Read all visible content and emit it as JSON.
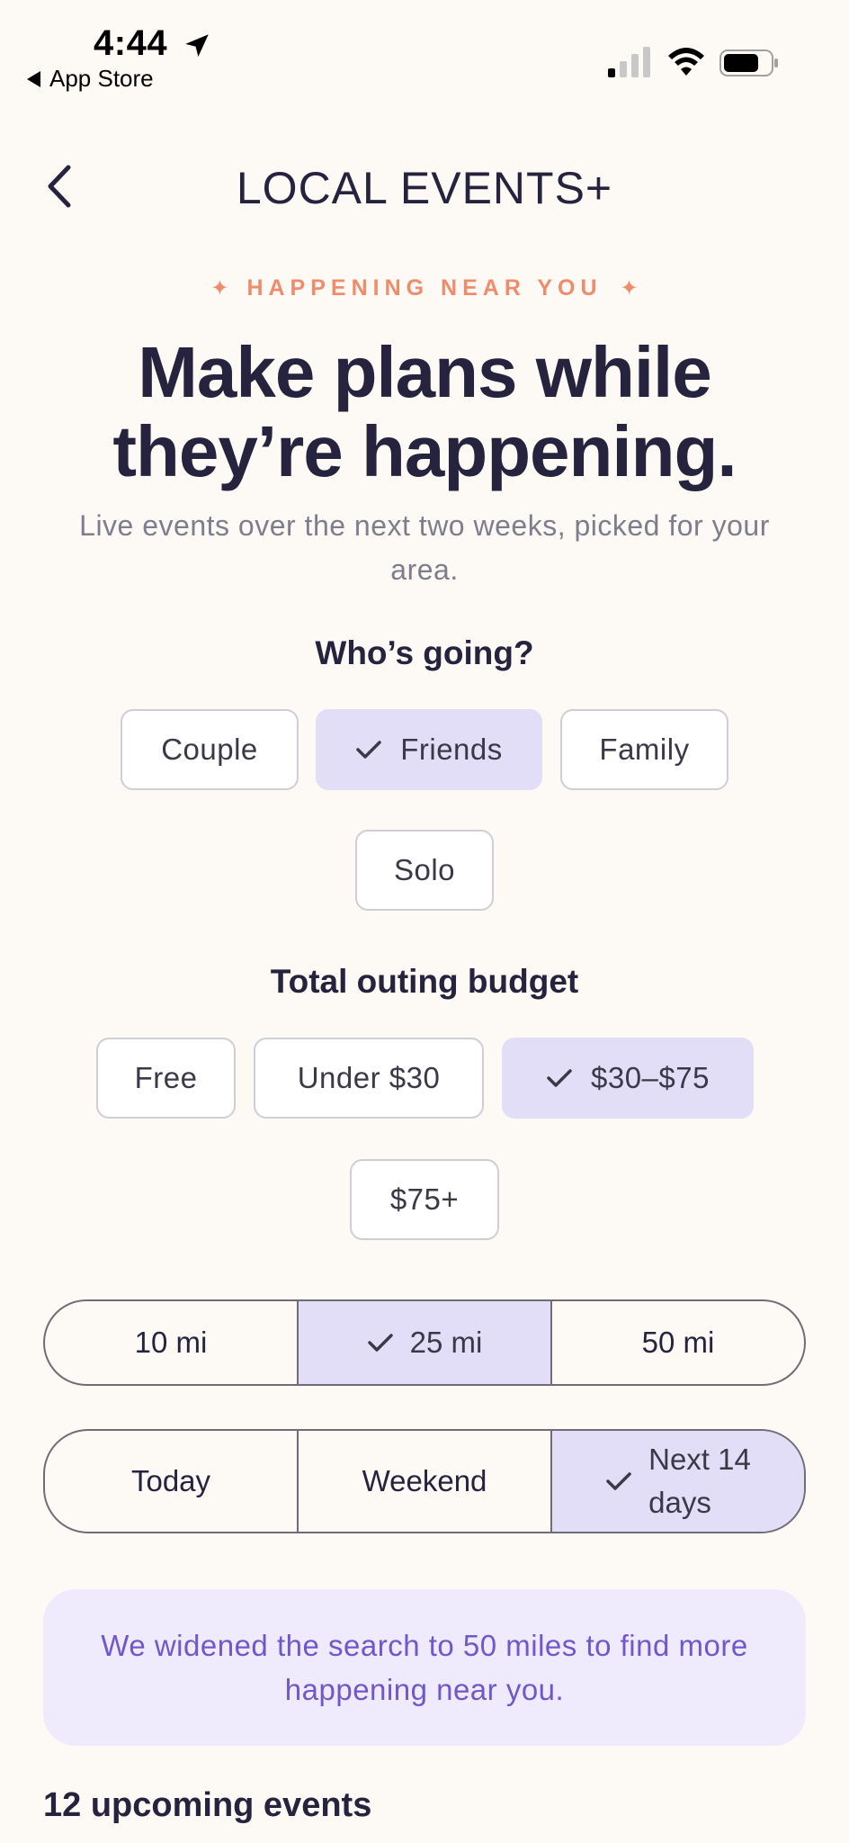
{
  "status_bar": {
    "time": "4:44",
    "back_app": "App Store"
  },
  "header": {
    "title": "LOCAL EVENTS+"
  },
  "hero": {
    "eyebrow": "HAPPENING NEAR YOU",
    "headline_line1": "Make plans while",
    "headline_line2": "they’re happening.",
    "subtext": "Live events over the next two weeks, picked for your area."
  },
  "who": {
    "label": "Who’s going?",
    "options": [
      "Couple",
      "Friends",
      "Family",
      "Solo"
    ],
    "selected": "Friends"
  },
  "budget": {
    "label": "Total outing budget",
    "options": [
      "Free",
      "Under $30",
      "$30–$75",
      "$75+"
    ],
    "selected": "$30–$75"
  },
  "distance": {
    "options": [
      "10 mi",
      "25 mi",
      "50 mi"
    ],
    "selected": "25 mi"
  },
  "timeframe": {
    "options": [
      "Today",
      "Weekend",
      "Next 14 days"
    ],
    "next14_line1": "Next 14",
    "next14_line2": "days",
    "selected": "Next 14 days"
  },
  "notice": "We widened the search to 50 miles to find more happening near you.",
  "results": {
    "count_label": "12 upcoming events"
  },
  "colors": {
    "accent": "#ee8c6c",
    "selected_bg": "#e3def7",
    "notice_bg": "#efebfd",
    "notice_text": "#6f58c9",
    "text": "#25233d"
  }
}
